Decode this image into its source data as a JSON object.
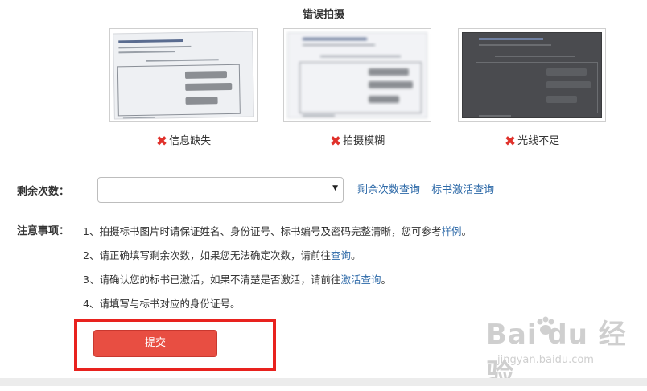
{
  "header": {
    "title": "错误拍摄"
  },
  "samples": [
    {
      "caption": "信息缺失",
      "style": "cropped"
    },
    {
      "caption": "拍摄模糊",
      "style": "blurry"
    },
    {
      "caption": "光线不足",
      "style": "dark"
    }
  ],
  "icons": {
    "error": "x-mark-icon",
    "dropdown": "triangle-down-icon",
    "watermark": "paw-icon"
  },
  "colors": {
    "error": "#e0312b",
    "link": "#2e6aa8",
    "submit": "#e84e42",
    "highlight": "#e8221e"
  },
  "form": {
    "remaining_label": "剩余次数：",
    "select_value": "",
    "links": {
      "query_remaining": "剩余次数查询",
      "activation_query": "标书激活查询"
    },
    "notes_label": "注意事项：",
    "notes": [
      {
        "text": "1、拍摄标书图片时请保证姓名、身份证号、标书编号及密码完整清晰，您可参考",
        "link": "样例",
        "suffix": "。"
      },
      {
        "text": "2、请正确填写剩余次数，如果您无法确定次数，请前往",
        "link": "查询",
        "suffix": "。"
      },
      {
        "text": "3、请确认您的标书已激活，如果不清楚是否激活，请前往",
        "link": "激活查询",
        "suffix": "。"
      },
      {
        "text": "4、请填写与标书对应的身份证号。",
        "link": "",
        "suffix": ""
      }
    ],
    "submit_label": "提交"
  },
  "watermark": {
    "brand": "Bai du 经验",
    "url": "jingyan.baidu.com"
  }
}
